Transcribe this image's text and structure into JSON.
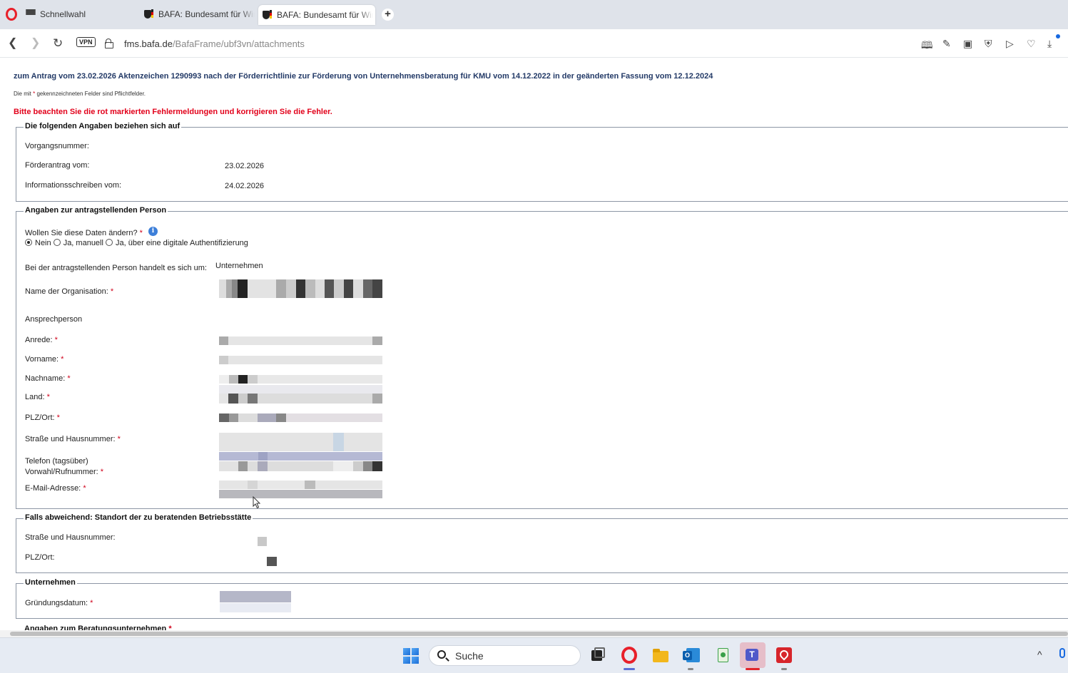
{
  "browser": {
    "tabs": [
      {
        "label": "Schnellwahl"
      },
      {
        "label": "BAFA: Bundesamt für Wirtschaft"
      },
      {
        "label": "BAFA: Bundesamt für Wirtschaft"
      }
    ],
    "newtab_label": "+",
    "vpn_label": "VPN",
    "url_host": "fms.bafa.de",
    "url_path": "/BafaFrame/ubf3vn/attachments"
  },
  "page": {
    "intro": "zum Antrag vom 23.02.2026 Aktenzeichen 1290993 nach der Förderrichtlinie zur Förderung von Unternehmensberatung für KMU vom 14.12.2022 in der geänderten Fassung vom 12.12.2024",
    "mandatory_prefix": "Die mit",
    "mandatory_star": "*",
    "mandatory_suffix": "gekennzeichneten Felder sind Pflichtfelder.",
    "error": "Bitte beachten Sie die rot markierten Fehlermeldungen und korrigieren Sie die Fehler.",
    "star": "*"
  },
  "section_reference": {
    "legend": "Die folgenden Angaben beziehen sich auf",
    "vorgangsnummer_label": "Vorgangsnummer:",
    "foerderantrag_label": "Förderantrag vom:",
    "foerderantrag_value": "23.02.2026",
    "info_label": "Informationsschreiben vom:",
    "info_value": "24.02.2026"
  },
  "section_applicant": {
    "legend": "Angaben zur antragstellenden Person",
    "change_question": "Wollen Sie diese Daten ändern?",
    "info_icon": "i",
    "radio_options": [
      "Nein",
      "Ja, manuell",
      "Ja, über eine digitale Authentifizierung"
    ],
    "radio_selected": "Nein",
    "person_type_label": "Bei der antragstellenden Person handelt es sich um:",
    "person_type_value": "Unternehmen",
    "org_label": "Name der Organisation:",
    "contact_heading": "Ansprechperson",
    "anrede_label": "Anrede:",
    "vorname_label": "Vorname:",
    "nachname_label": "Nachname:",
    "land_label": "Land:",
    "plz_label": "PLZ/Ort:",
    "strasse_label": "Straße und Hausnummer:",
    "telefon_label_1": "Telefon (tagsüber)",
    "telefon_label_2": "Vorwahl/Rufnummer:",
    "email_label": "E-Mail-Adresse:"
  },
  "section_site": {
    "legend": "Falls abweichend: Standort der zu beratenden Betriebsstätte",
    "strasse_label": "Straße und Hausnummer:",
    "plz_label": "PLZ/Ort:"
  },
  "section_company": {
    "legend": "Unternehmen",
    "gruendung_label": "Gründungsdatum:"
  },
  "section_consulting": {
    "legend": "Angaben zum Beratungsunternehmen"
  },
  "taskbar": {
    "search_label": "Suche",
    "chevron": "^"
  },
  "colors": {
    "heading_blue": "#233a67",
    "error_red": "#e2001a",
    "star_red": "#d0021b",
    "opera_red": "#e8202a",
    "info_blue": "#3d7fd9"
  }
}
